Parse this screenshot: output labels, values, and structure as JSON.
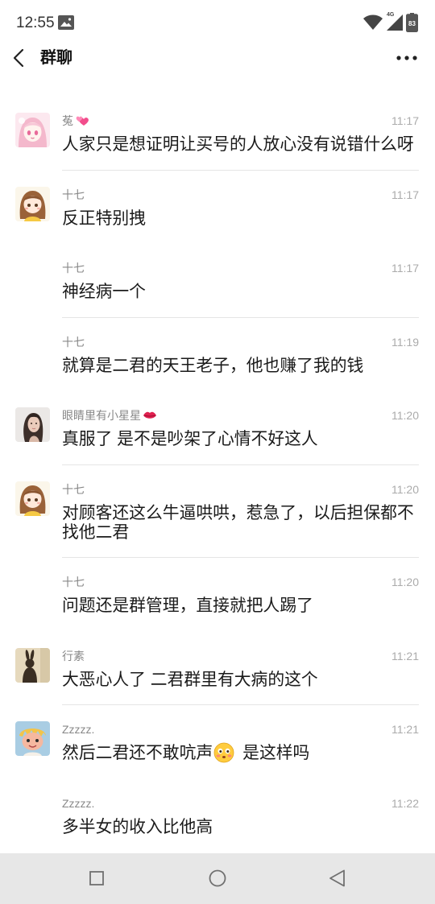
{
  "status_bar": {
    "time": "12:55",
    "notification_icon": "gallery-image-icon",
    "wifi_icon": "wifi-icon",
    "signal_icon": "cell-signal-icon",
    "network": "4G",
    "battery": "83"
  },
  "header": {
    "title": "群聊",
    "back_icon": "chevron-left-icon",
    "more_icon": "more-dots-icon"
  },
  "messages": [
    {
      "sender": "菟",
      "sender_emoji": "two-hearts-icon",
      "time": "11:17",
      "text": "人家只是想证明让买号的人放心没有说错什么呀",
      "avatar": "pink-anime-girl-avatar"
    },
    {
      "sender": "十七",
      "time": "11:17",
      "text": "反正特别拽",
      "avatar": "brown-hair-girl-avatar"
    },
    {
      "sender": "十七",
      "time": "11:17",
      "text": "神经病一个"
    },
    {
      "sender": "十七",
      "time": "11:19",
      "text": "就算是二君的天王老子，他也赚了我的钱"
    },
    {
      "sender": "眼睛里有小星星",
      "sender_emoji": "kiss-mark-icon",
      "time": "11:20",
      "text": "真服了 是不是吵架了心情不好这人",
      "avatar": "woman-photo-avatar"
    },
    {
      "sender": "十七",
      "time": "11:20",
      "text": "对顾客还这么牛逼哄哄，惹急了，以后担保都不找他二君",
      "avatar": "brown-hair-girl-avatar"
    },
    {
      "sender": "十七",
      "time": "11:20",
      "text": "问题还是群管理，直接就把人踢了"
    },
    {
      "sender": "行素",
      "time": "11:21",
      "text": "大恶心人了 二君群里有大病的这个",
      "avatar": "rabbit-silhouette-avatar"
    },
    {
      "sender": "Zzzzz.",
      "time": "11:21",
      "text_before_emoji": "然后二君还不敢吭声",
      "text_emoji": "flushed-face-icon",
      "text_after_emoji": "是这样吗",
      "avatar": "cartoon-character-avatar"
    },
    {
      "sender": "Zzzzz.",
      "time": "11:22",
      "text": "多半女的收入比他高"
    }
  ],
  "nav_bar": {
    "recent_icon": "recent-apps-icon",
    "home_icon": "home-circle-icon",
    "back_icon": "back-triangle-icon"
  }
}
